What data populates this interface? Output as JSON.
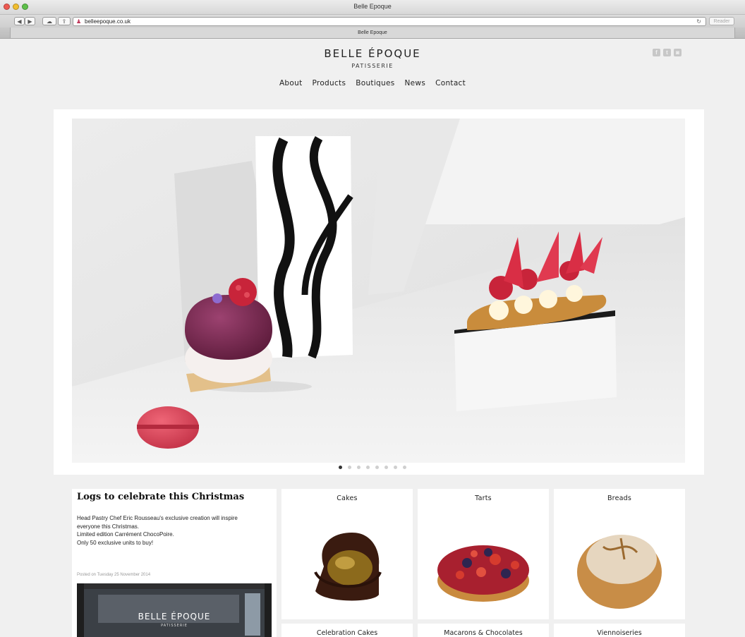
{
  "window": {
    "title": "Belle Epoque",
    "tab_title": "Belle Epoque"
  },
  "toolbar": {
    "url": "belleepoque.co.uk",
    "reader_label": "Reader"
  },
  "header": {
    "logo_main": "BELLE ÉPOQUE",
    "logo_sub": "PATISSERIE",
    "social": [
      "f",
      "t",
      "◙"
    ]
  },
  "nav": {
    "items": [
      "About",
      "Products",
      "Boutiques",
      "News",
      "Contact"
    ]
  },
  "slider": {
    "slide_count": 8,
    "active_slide": 1
  },
  "news": {
    "title": "Logs to celebrate this Christmas",
    "lines": [
      "Head Pastry Chef Eric Rousseau's exclusive creation will inspire",
      "everyone this Christmas.",
      "Limited edition Carrément ChocoPoire.",
      "Only 50 exclusive units to buy!"
    ],
    "date": "Posted on Tuesday 25 November 2014",
    "photo_sign": "BELLE ÉPOQUE",
    "photo_sign_sub": "PATISSERIE"
  },
  "products": [
    {
      "label": "Cakes"
    },
    {
      "label": "Tarts"
    },
    {
      "label": "Breads"
    },
    {
      "label": "Celebration Cakes"
    },
    {
      "label": "Macarons & Chocolates"
    },
    {
      "label": "Viennoiseries"
    }
  ],
  "colors": {
    "accent_raspberry": "#c8243a",
    "macaron_purple": "#7d2a52",
    "macaron_pink": "#e0485c"
  }
}
